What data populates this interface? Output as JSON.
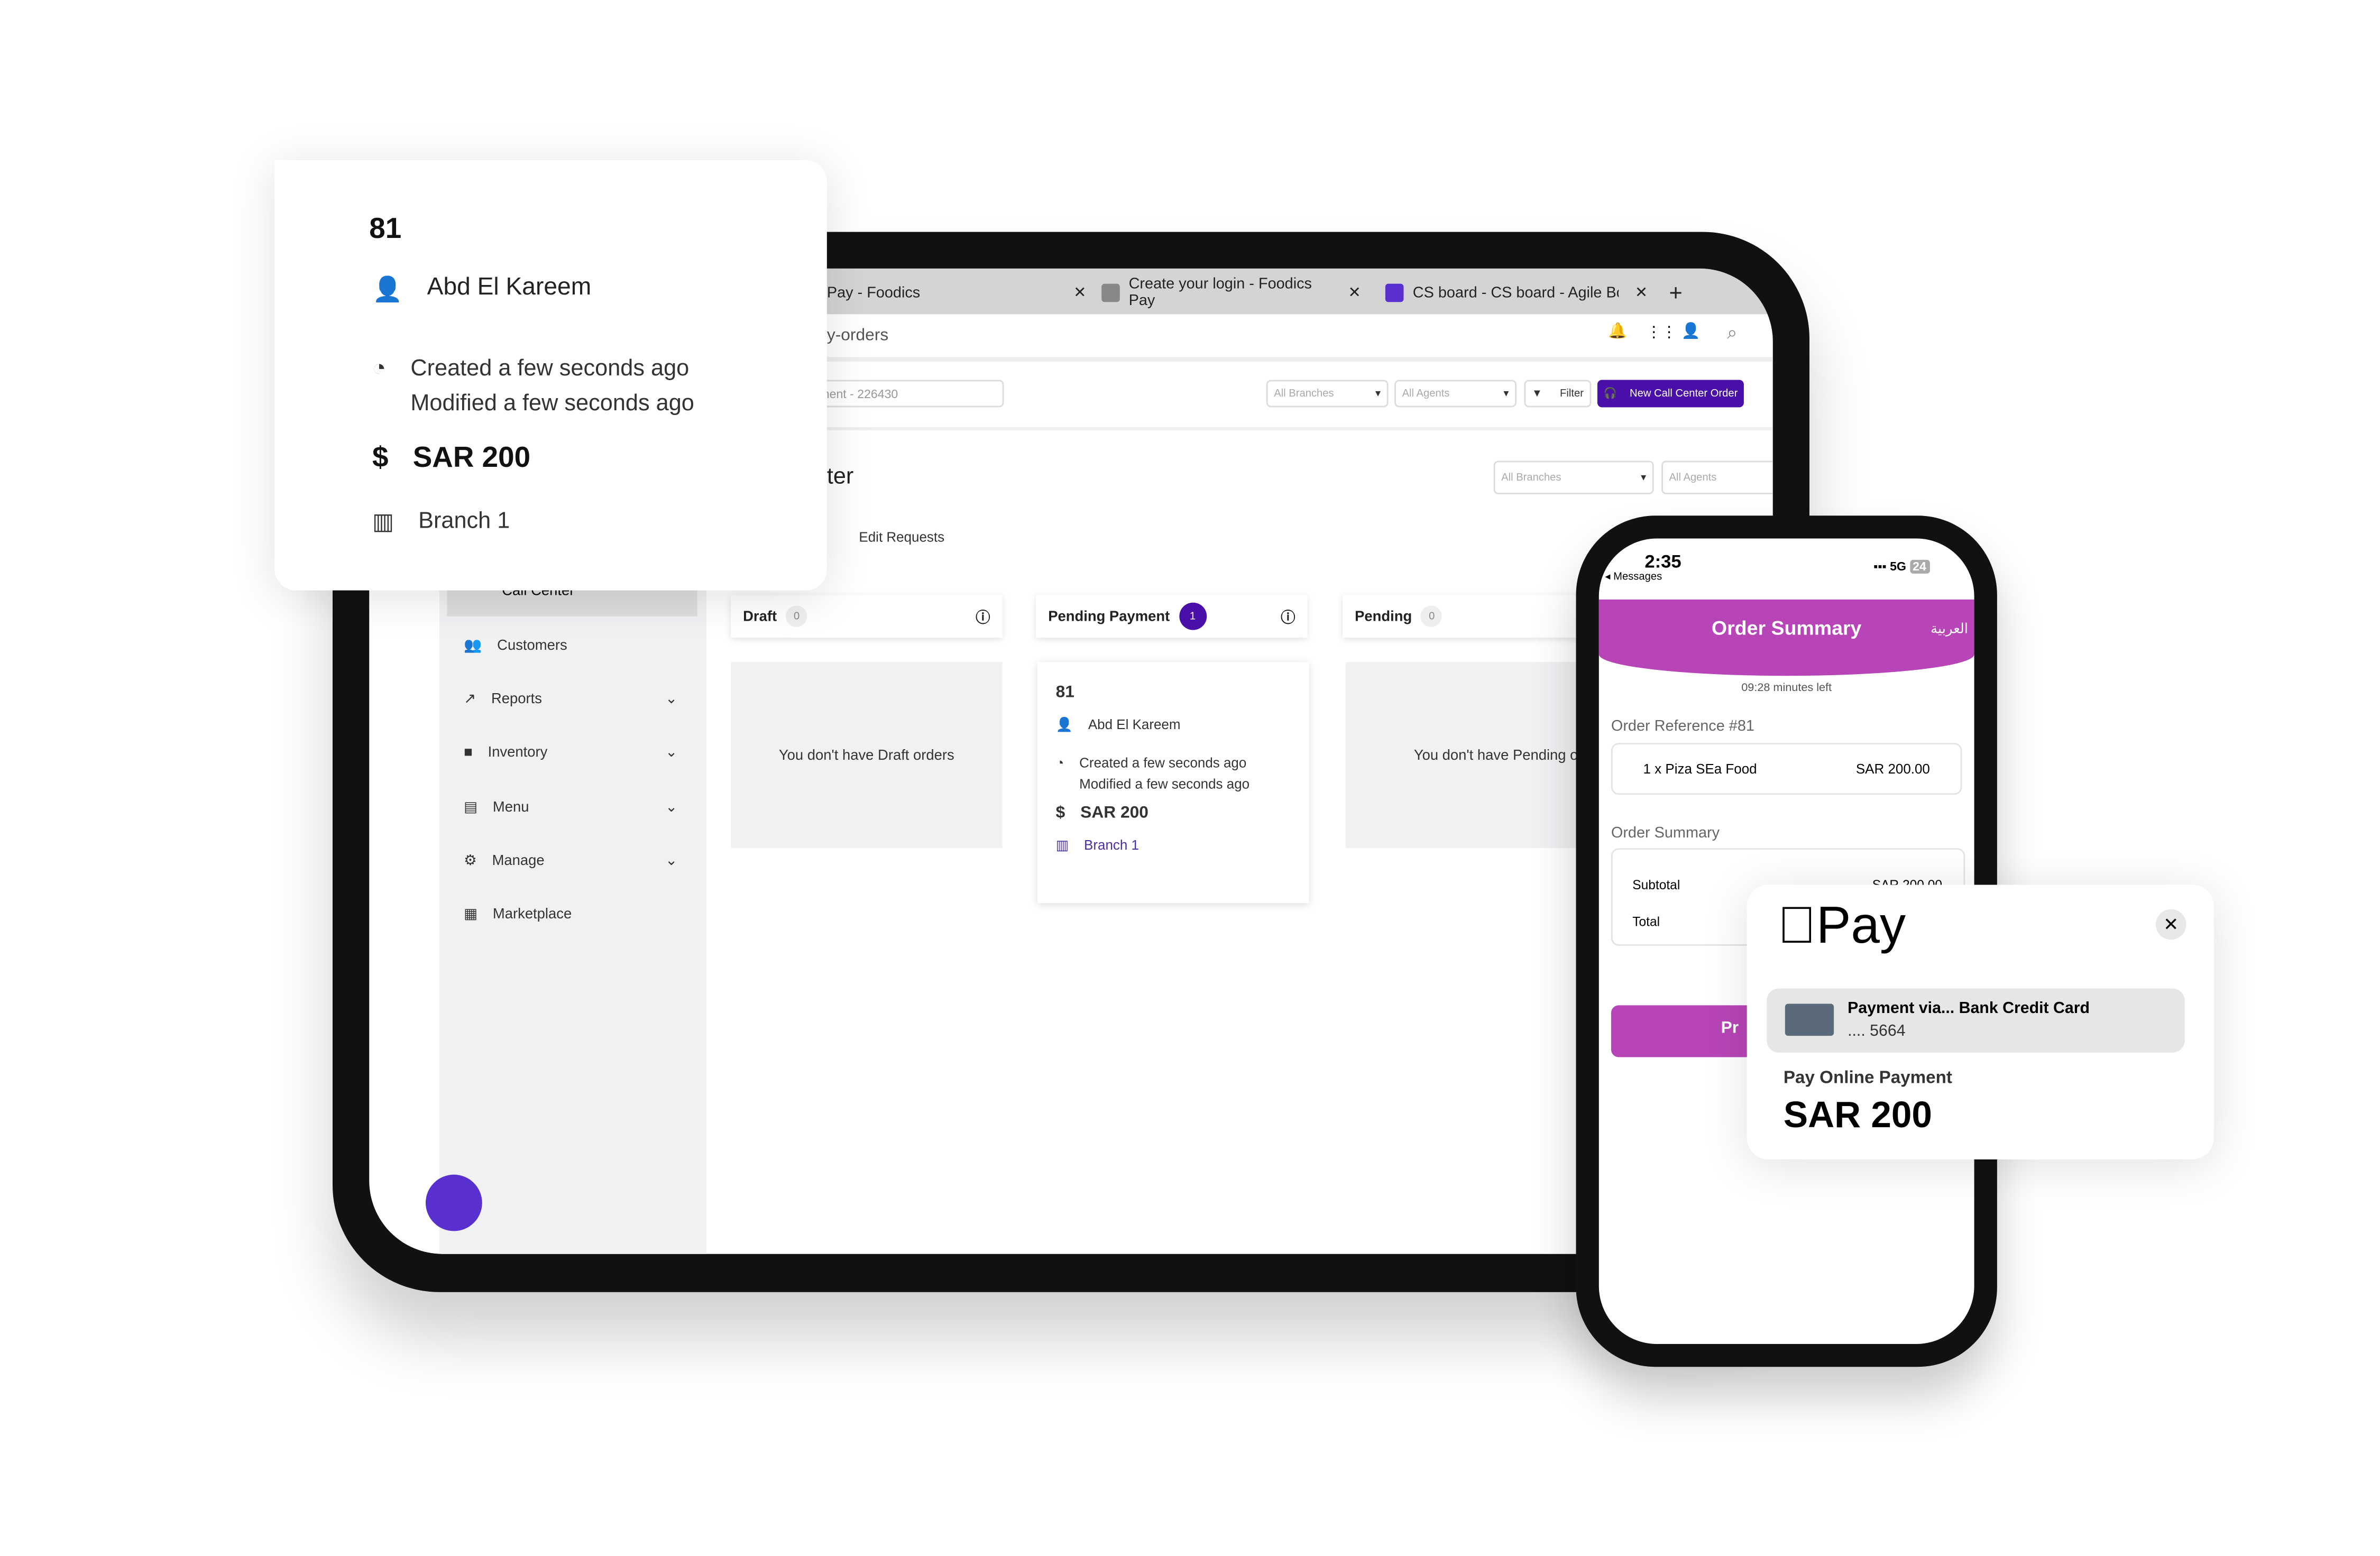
{
  "browser": {
    "tabs": [
      {
        "title": "Pay - Foodics"
      },
      {
        "title": "Create your login - Foodics Pay"
      },
      {
        "title": "CS board - CS board - Agile Boar"
      }
    ],
    "new_tab": "+",
    "url_fragment": "y-orders",
    "notification_count": "0"
  },
  "toolbar": {
    "search_value": "ment - 226430",
    "branches": "All Branches",
    "agents": "All Agents",
    "filter": "Filter",
    "new_order": "New Call Center Order"
  },
  "page": {
    "title_fragment": "ter",
    "branches": "All Branches",
    "agents": "All Agents",
    "tab_edit_requests": "Edit Requests"
  },
  "sidebar": {
    "items": [
      {
        "label": "Call Center"
      },
      {
        "label": "Customers"
      },
      {
        "label": "Reports"
      },
      {
        "label": "Inventory"
      },
      {
        "label": "Menu"
      },
      {
        "label": "Manage"
      },
      {
        "label": "Marketplace"
      }
    ]
  },
  "board": {
    "columns": [
      {
        "name": "Draft",
        "count": "0",
        "empty": "You don't have Draft orders"
      },
      {
        "name": "Pending Payment",
        "count": "1"
      },
      {
        "name": "Pending",
        "count": "0",
        "empty": "You don't have Pending orders"
      }
    ],
    "order": {
      "number": "81",
      "customer": "Abd El Kareem",
      "created": "Created a few seconds ago",
      "modified": "Modified a few seconds ago",
      "amount": "SAR 200",
      "branch": "Branch 1"
    }
  },
  "phone": {
    "time": "2:35",
    "back": "Messages",
    "signal": "5G",
    "battery": "24",
    "header": "Order Summary",
    "lang": "العربية",
    "timer": "09:28 minutes left",
    "order_ref": "Order Reference #81",
    "item_qty": "1 x",
    "item_name": "Piza SEa Food",
    "item_price": "SAR 200.00",
    "summary_title": "Order Summary",
    "subtotal_label": "Subtotal",
    "subtotal_value": "SAR 200.00",
    "total_label": "Total",
    "pay_button_fragment": "Pr"
  },
  "applepay": {
    "logo": "Pay",
    "method": "Payment via... Bank Credit Card",
    "card": ".... 5664",
    "label": "Pay Online Payment",
    "amount": "SAR 200"
  },
  "colors": {
    "brand": "#4a0fa8",
    "phone_header": "#b845b8"
  }
}
